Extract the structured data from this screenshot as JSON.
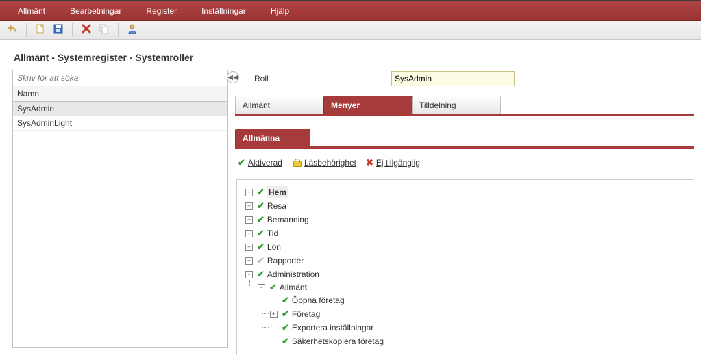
{
  "menu": [
    "Allmänt",
    "Bearbetningar",
    "Register",
    "Inställningar",
    "Hjälp"
  ],
  "breadcrumb": "Allmänt - Systemregister - Systemroller",
  "search": {
    "placeholder": "Skriv för att söka"
  },
  "list": {
    "header": "Namn",
    "rows": [
      "SysAdmin",
      "SysAdminLight"
    ],
    "selected": 0
  },
  "form": {
    "role_label": "Roll",
    "role_value": "SysAdmin"
  },
  "tabs": {
    "items": [
      "Allmänt",
      "Menyer",
      "Tilldelning"
    ],
    "active": 1
  },
  "subtabs": {
    "items": [
      "Allmänna"
    ],
    "active": 0
  },
  "legend": {
    "activated": "Aktiverad",
    "read": "Läsbehörighet",
    "unavailable": "Ej tillgänglig"
  },
  "tree": [
    {
      "label": "Hem",
      "state": "check",
      "toggle": "+",
      "bold": true
    },
    {
      "label": "Resa",
      "state": "check",
      "toggle": "+"
    },
    {
      "label": "Bemanning",
      "state": "check",
      "toggle": "+"
    },
    {
      "label": "Tid",
      "state": "check",
      "toggle": "+"
    },
    {
      "label": "Lön",
      "state": "check",
      "toggle": "+"
    },
    {
      "label": "Rapporter",
      "state": "check-grey",
      "toggle": "+"
    },
    {
      "label": "Administration",
      "state": "check",
      "toggle": "-",
      "children": [
        {
          "label": "Allmänt",
          "state": "check",
          "toggle": "-",
          "children": [
            {
              "label": "Öppna företag",
              "state": "check",
              "toggle": ""
            },
            {
              "label": "Företag",
              "state": "check",
              "toggle": "+"
            },
            {
              "label": "Exportera inställningar",
              "state": "check",
              "toggle": ""
            },
            {
              "label": "Säkerhetskopiera företag",
              "state": "check",
              "toggle": ""
            }
          ]
        }
      ]
    }
  ]
}
